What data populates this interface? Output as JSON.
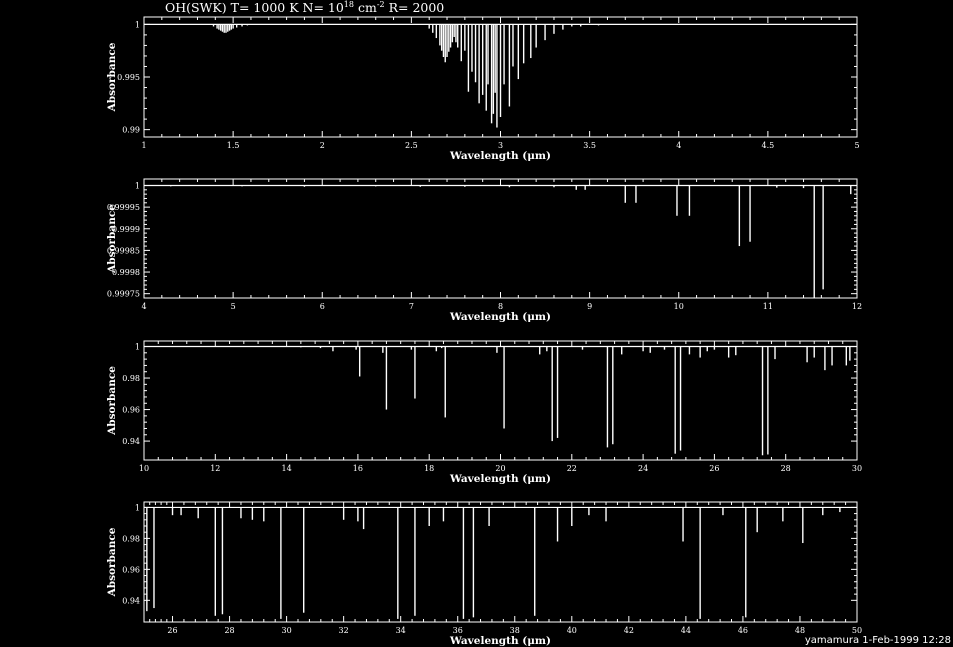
{
  "title": {
    "main": "OH(SWK) T= 1000 K N= 10",
    "exp1": "18",
    "mid": " cm",
    "exp2": "-2",
    "tail": " R= 2000"
  },
  "footer": "yamamura  1-Feb-1999 12:28",
  "colors": {
    "background": "#000000",
    "foreground": "#ffffff"
  },
  "chart_data": [
    {
      "type": "line",
      "xlabel": "Wavelength (μm)",
      "ylabel": "Absorbance",
      "xlim": [
        1,
        5
      ],
      "ylim": [
        0.9893,
        1.0007
      ],
      "xticks": [
        1,
        1.5,
        2,
        2.5,
        3,
        3.5,
        4,
        4.5,
        5
      ],
      "xtick_labels": [
        "1",
        "1.5",
        "2",
        "2.5",
        "3",
        "3.5",
        "4",
        "4.5",
        "5"
      ],
      "yticks": [
        0.99,
        0.995,
        1
      ],
      "ytick_labels": [
        "0.99",
        "0.995",
        "1"
      ],
      "baseline": 1,
      "series": [
        {
          "x": [
            1.39,
            1.41,
            1.42,
            1.43,
            1.44,
            1.45,
            1.46,
            1.47,
            1.48,
            1.49,
            1.5,
            1.52,
            1.55,
            1.58,
            2.6,
            2.62,
            2.64,
            2.66,
            2.67,
            2.68,
            2.69,
            2.7,
            2.71,
            2.72,
            2.73,
            2.74,
            2.75,
            2.76,
            2.78,
            2.8,
            2.82,
            2.84,
            2.86,
            2.88,
            2.9,
            2.92,
            2.93,
            2.95,
            2.96,
            2.97,
            2.98,
            3.0,
            3.02,
            3.05,
            3.07,
            3.1,
            3.13,
            3.17,
            3.2,
            3.25,
            3.3,
            3.35,
            3.4,
            3.45,
            3.55
          ],
          "y": [
            0.9998,
            0.9996,
            0.9995,
            0.9994,
            0.9993,
            0.9992,
            0.9992,
            0.9993,
            0.9994,
            0.9995,
            0.9996,
            0.9997,
            0.9998,
            0.9999,
            0.9996,
            0.9992,
            0.9987,
            0.998,
            0.9975,
            0.9969,
            0.9964,
            0.9969,
            0.9974,
            0.9978,
            0.9983,
            0.9988,
            0.9983,
            0.9978,
            0.9965,
            0.9975,
            0.9936,
            0.9955,
            0.9945,
            0.9925,
            0.9933,
            0.9918,
            0.9943,
            0.9906,
            0.9915,
            0.9935,
            0.9902,
            0.9912,
            0.9943,
            0.9922,
            0.996,
            0.9948,
            0.9963,
            0.9968,
            0.9978,
            0.9985,
            0.9991,
            0.9995,
            0.9998,
            0.9998,
            0.9999
          ]
        }
      ]
    },
    {
      "type": "line",
      "xlabel": "Wavelength (μm)",
      "ylabel": "Absorbance",
      "xlim": [
        4,
        12
      ],
      "ylim": [
        0.99974,
        1.000015
      ],
      "xticks": [
        4,
        5,
        6,
        7,
        8,
        9,
        10,
        11,
        12
      ],
      "xtick_labels": [
        "4",
        "5",
        "6",
        "7",
        "8",
        "9",
        "10",
        "11",
        "12"
      ],
      "yticks": [
        0.99975,
        0.9998,
        0.99985,
        0.9999,
        0.99995,
        1
      ],
      "ytick_labels": [
        "0.99975",
        "0.9998",
        "0.99985",
        "0.9999",
        "0.99995",
        "1"
      ],
      "baseline": 1,
      "series": [
        {
          "x": [
            4.3,
            5.1,
            5.8,
            6.6,
            7.1,
            7.6,
            8.1,
            8.6,
            8.85,
            8.95,
            9.4,
            9.52,
            9.98,
            10.12,
            10.68,
            10.8,
            11.1,
            11.4,
            11.52,
            11.62,
            11.93
          ],
          "y": [
            0.999998,
            0.999998,
            0.999997,
            0.999998,
            0.999997,
            0.999997,
            0.999996,
            0.999996,
            0.99999,
            0.99999,
            0.99996,
            0.99996,
            0.99993,
            0.99993,
            0.99986,
            0.99987,
            0.999995,
            0.999994,
            0.99974,
            0.99976,
            0.99998
          ]
        }
      ]
    },
    {
      "type": "line",
      "xlabel": "Wavelength (μm)",
      "ylabel": "Absorbance",
      "xlim": [
        10,
        30
      ],
      "ylim": [
        0.928,
        1.0035
      ],
      "xticks": [
        10,
        12,
        14,
        16,
        18,
        20,
        22,
        24,
        26,
        28,
        30
      ],
      "xtick_labels": [
        "10",
        "12",
        "14",
        "16",
        "18",
        "20",
        "22",
        "24",
        "26",
        "28",
        "30"
      ],
      "yticks": [
        0.94,
        0.96,
        0.98,
        1
      ],
      "ytick_labels": [
        "0.94",
        "0.96",
        "0.98",
        "1"
      ],
      "baseline": 1,
      "series": [
        {
          "x": [
            14.4,
            14.95,
            15.3,
            15.95,
            16.05,
            16.7,
            16.8,
            17.5,
            17.6,
            18.2,
            18.35,
            18.45,
            19.9,
            20.1,
            21.1,
            21.3,
            21.45,
            21.6,
            22.3,
            23.0,
            23.15,
            23.4,
            24.0,
            24.2,
            24.6,
            24.9,
            25.05,
            25.3,
            25.6,
            25.8,
            26.0,
            26.4,
            26.6,
            27.35,
            27.5,
            27.7,
            28.6,
            28.8,
            29.1,
            29.3,
            29.7,
            29.8
          ],
          "y": [
            0.9995,
            0.999,
            0.997,
            0.998,
            0.981,
            0.996,
            0.96,
            0.998,
            0.967,
            0.997,
            0.999,
            0.955,
            0.996,
            0.948,
            0.995,
            0.997,
            0.94,
            0.942,
            0.998,
            0.936,
            0.938,
            0.995,
            0.997,
            0.996,
            0.998,
            0.932,
            0.934,
            0.995,
            0.993,
            0.997,
            0.998,
            0.993,
            0.9945,
            0.931,
            0.9315,
            0.992,
            0.99,
            0.993,
            0.985,
            0.988,
            0.988,
            0.991
          ]
        }
      ]
    },
    {
      "type": "line",
      "xlabel": "Wavelength (μm)",
      "ylabel": "Absorbance",
      "xlim": [
        25,
        50
      ],
      "ylim": [
        0.926,
        1.0035
      ],
      "xticks": [
        25,
        26,
        28,
        30,
        32,
        34,
        36,
        38,
        40,
        42,
        44,
        46,
        48,
        50
      ],
      "xtick_labels": [
        "",
        "26",
        "28",
        "30",
        "32",
        "34",
        "36",
        "38",
        "40",
        "42",
        "44",
        "46",
        "48",
        "50"
      ],
      "yticks": [
        0.94,
        0.96,
        0.98,
        1
      ],
      "ytick_labels": [
        "0.94",
        "0.96",
        "0.98",
        "1"
      ],
      "baseline": 1,
      "series": [
        {
          "x": [
            25.1,
            25.35,
            26.0,
            26.3,
            26.9,
            27.5,
            27.75,
            28.4,
            28.8,
            29.2,
            29.8,
            30.6,
            32.0,
            32.5,
            32.7,
            33.9,
            34.5,
            35.0,
            35.5,
            36.2,
            36.55,
            37.1,
            38.7,
            39.5,
            40.0,
            40.6,
            41.2,
            43.9,
            44.5,
            45.3,
            46.1,
            46.5,
            47.4,
            48.1,
            48.8,
            49.4
          ],
          "y": [
            0.933,
            0.935,
            0.995,
            0.995,
            0.993,
            0.93,
            0.931,
            0.993,
            0.992,
            0.991,
            0.928,
            0.932,
            0.992,
            0.991,
            0.986,
            0.928,
            0.93,
            0.988,
            0.991,
            0.928,
            0.929,
            0.988,
            0.93,
            0.978,
            0.988,
            0.995,
            0.991,
            0.978,
            0.928,
            0.995,
            0.929,
            0.984,
            0.991,
            0.977,
            0.995,
            0.997
          ]
        }
      ]
    }
  ]
}
